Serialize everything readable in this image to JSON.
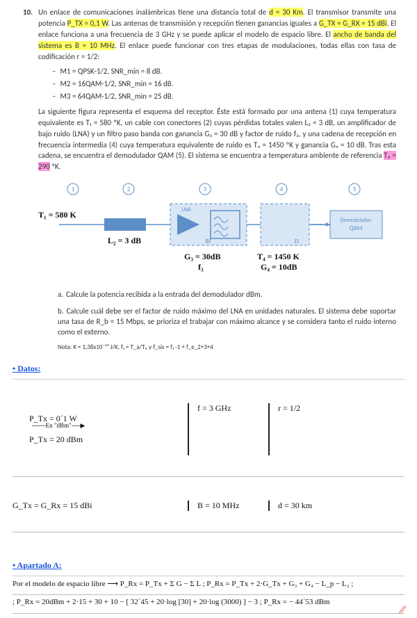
{
  "problem": {
    "number": "10.",
    "intro_a": "Un enlace de comunicaciones inalámbricas tiene una distancia total de ",
    "hl_d": "d = 30 Km",
    "intro_b": ". El transmisor transmite una potencia ",
    "hl_ptx": "P_TX = 0,1 W",
    "intro_c": ". Las antenas de transmisión y recepción tienen ganancias iguales a ",
    "hl_g": "G_TX = G_RX = 15 dBi",
    "intro_d": ". El enlace funciona a una frecuencia de 3 GHz y se puede aplicar el modelo de espacio libre. El ",
    "hl_bw1": "ancho de banda del sistema es B = 10 MHz",
    "intro_e": ". El enlace puede funcionar con tres etapas de modulaciones, todas ellas con tasa de codificación r = 1/2:"
  },
  "mods": [
    "M1 = QPSK-1/2, SNR_min = 8 dB.",
    "M2 = 16QAM-1/2, SNR_min = 16 dB.",
    "M3 = 64QAM-1/2, SNR_min = 25 dB."
  ],
  "rx_para_a": "La siguiente figura representa el esquema del receptor. Éste está formado por una antena (1) cuya temperatura equivalente es T₁ = 580 ºK, un cable con conectores (2) cuyas pérdidas totales valen L₂ = 3 dB, un amplificador de bajo ruido (LNA) y un filtro paso banda con ganancia G₃ = 30 dB y factor de ruido f₃, y una cadena de recepción en frecuencia intermedia (4) cuya temperatura equivalente de ruido es T₄ = 1450 ºK y ganancia G₄ = 10 dB. Tras esta cadena, se encuentra el demodulador QAM (5). El sistema se encuentra a temperatura ambiente de referencia ",
  "hl_t0": "T₀ = 290",
  "rx_para_b": " ºK.",
  "diagram": {
    "nodes": [
      "1",
      "2",
      "3",
      "4",
      "5"
    ],
    "lna": "LNA",
    "rf": "RF",
    "fi": "FI",
    "demod_a": "Demodulador",
    "demod_b": "QAM",
    "ann_t1": "T₁ = 580 K",
    "ann_l2": "L₂ = 3 dB",
    "ann_g3": "G₃ = 30dB",
    "ann_f3": "f₃",
    "ann_t4": "T₄ = 1450 K",
    "ann_g4": "G₄ = 10dB"
  },
  "tasks": {
    "a": "Calcule la potencia recibida a la entrada del demodulador dBm.",
    "b": "Calcule cuál debe ser el factor de ruido máximo del LNA en unidades naturales. El sistema debe soportar una tasa de R_b = 15 Mbps, se prioriza el trabajar con máximo alcance y se considera tanto el ruido interno como el externo."
  },
  "nota": "Nota: K = 1,38x10⁻²³ J/K, f₁ = T_a/T₀ y f_sis = f₁ -1 + f_e_2+3+4",
  "hw": {
    "datos_title": "• Datos:",
    "l1_col1a": "P_Tx = 0´1 W",
    "l1_arrow": "En \"dBm\"",
    "l1_col1b": "P_Tx = 20 dBm",
    "l1_col2": "f = 3 GHz",
    "l1_col3": "r = 1/2",
    "l2_col1": "G_Tx = G_Rx = 15 dBi",
    "l2_col2": "B = 10 MHz",
    "l2_col3": "d = 30 km",
    "apA_title": "• Apartado A:",
    "apA_l1": "Por el modelo de espacio libre ⟶ P_Rx = P_Tx + Σ G − Σ L ;  P_Rx = P_Tx + 2·G_Tx + G₃ + G₄ − L_p − L₂ ;",
    "apA_l2": "; P_Rx = 20dBm + 2·15 + 30 + 10 − [ 32´45 + 20·log [30] + 20·log (3000) ] − 3 ; P_Rx = − 44´53 dBm"
  }
}
